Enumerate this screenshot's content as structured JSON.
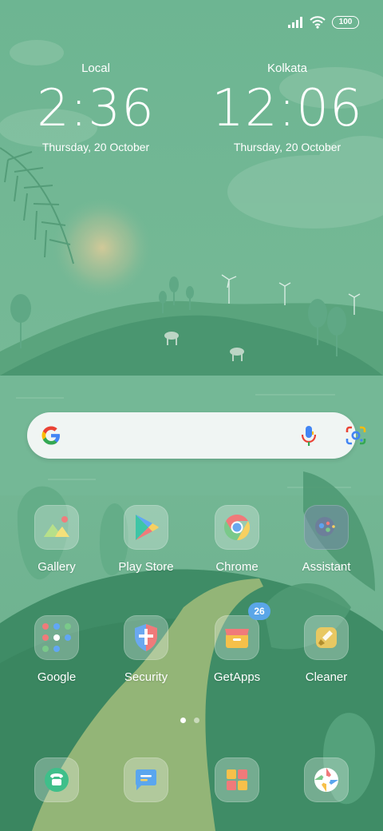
{
  "status_bar": {
    "signal_icon": "signal-icon",
    "wifi_icon": "wifi-icon",
    "battery_level": "100"
  },
  "clocks": [
    {
      "city": "Local",
      "time": "2:36",
      "date": "Thursday, 20 October"
    },
    {
      "city": "Kolkata",
      "time": "12:06",
      "date": "Thursday, 20 October"
    }
  ],
  "search": {
    "logo_icon": "google-g-icon",
    "mic_icon": "microphone-icon",
    "lens_icon": "google-lens-icon"
  },
  "apps": [
    {
      "label": "Gallery",
      "icon": "gallery-icon"
    },
    {
      "label": "Play Store",
      "icon": "play-store-icon"
    },
    {
      "label": "Chrome",
      "icon": "chrome-icon"
    },
    {
      "label": "Assistant",
      "icon": "assistant-icon"
    },
    {
      "label": "Google",
      "icon": "google-folder-icon"
    },
    {
      "label": "Security",
      "icon": "security-shield-icon"
    },
    {
      "label": "GetApps",
      "icon": "getapps-icon",
      "badge": "26"
    },
    {
      "label": "Cleaner",
      "icon": "cleaner-brush-icon"
    }
  ],
  "dock": [
    {
      "icon": "phone-icon"
    },
    {
      "icon": "messages-icon"
    },
    {
      "icon": "themes-icon"
    },
    {
      "icon": "camera-icon"
    }
  ],
  "pager": {
    "pages": 2,
    "current": 1
  },
  "colors": {
    "wallpaper_sky": "#6fb494",
    "hill_dark": "#3b8a63",
    "path": "#93b577"
  }
}
